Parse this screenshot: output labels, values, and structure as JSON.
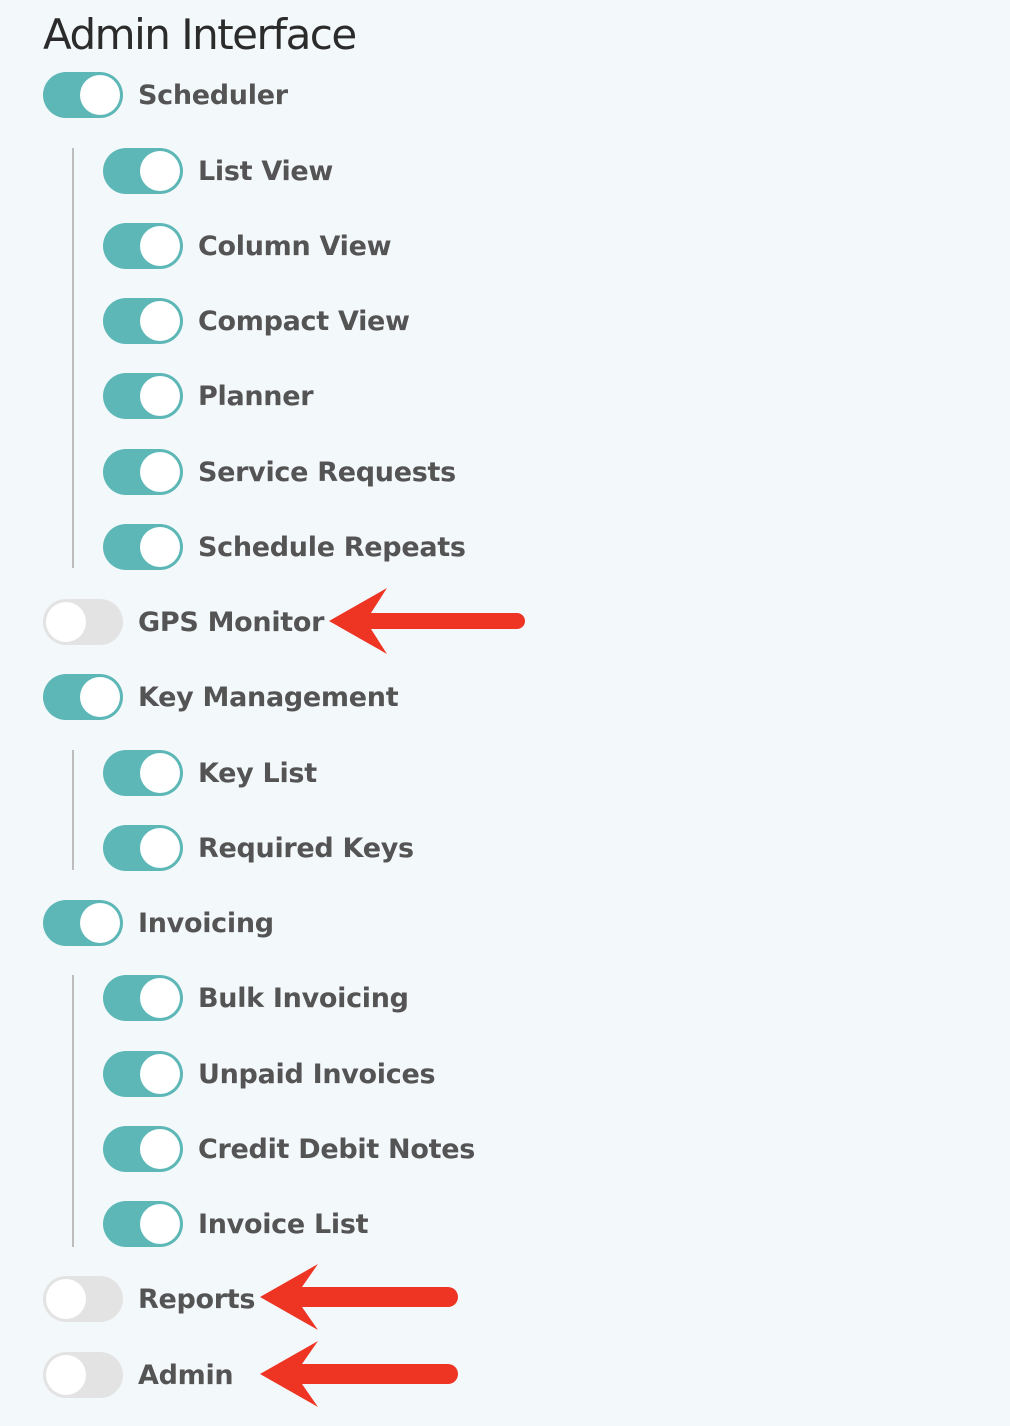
{
  "page": {
    "title": "Admin Interface"
  },
  "colors": {
    "toggle_on": "#5db7b7",
    "toggle_off": "#e3e3e3",
    "arrow": "#ee3524"
  },
  "items": [
    {
      "id": "scheduler",
      "label": "Scheduler",
      "enabled": true,
      "level": 0
    },
    {
      "id": "list-view",
      "label": "List View",
      "enabled": true,
      "level": 1
    },
    {
      "id": "column-view",
      "label": "Column View",
      "enabled": true,
      "level": 1
    },
    {
      "id": "compact-view",
      "label": "Compact View",
      "enabled": true,
      "level": 1
    },
    {
      "id": "planner",
      "label": "Planner",
      "enabled": true,
      "level": 1
    },
    {
      "id": "service-requests",
      "label": "Service Requests",
      "enabled": true,
      "level": 1
    },
    {
      "id": "schedule-repeats",
      "label": "Schedule Repeats",
      "enabled": true,
      "level": 1
    },
    {
      "id": "gps-monitor",
      "label": "GPS Monitor",
      "enabled": false,
      "level": 0,
      "annotated": true
    },
    {
      "id": "key-management",
      "label": "Key Management",
      "enabled": true,
      "level": 0
    },
    {
      "id": "key-list",
      "label": "Key List",
      "enabled": true,
      "level": 1
    },
    {
      "id": "required-keys",
      "label": "Required Keys",
      "enabled": true,
      "level": 1
    },
    {
      "id": "invoicing",
      "label": "Invoicing",
      "enabled": true,
      "level": 0
    },
    {
      "id": "bulk-invoicing",
      "label": "Bulk Invoicing",
      "enabled": true,
      "level": 1
    },
    {
      "id": "unpaid-invoices",
      "label": "Unpaid Invoices",
      "enabled": true,
      "level": 1
    },
    {
      "id": "credit-debit-notes",
      "label": "Credit Debit Notes",
      "enabled": true,
      "level": 1
    },
    {
      "id": "invoice-list",
      "label": "Invoice List",
      "enabled": true,
      "level": 1
    },
    {
      "id": "reports",
      "label": "Reports",
      "enabled": false,
      "level": 0,
      "annotated": true
    },
    {
      "id": "admin",
      "label": "Admin",
      "enabled": false,
      "level": 0,
      "annotated": true
    }
  ]
}
